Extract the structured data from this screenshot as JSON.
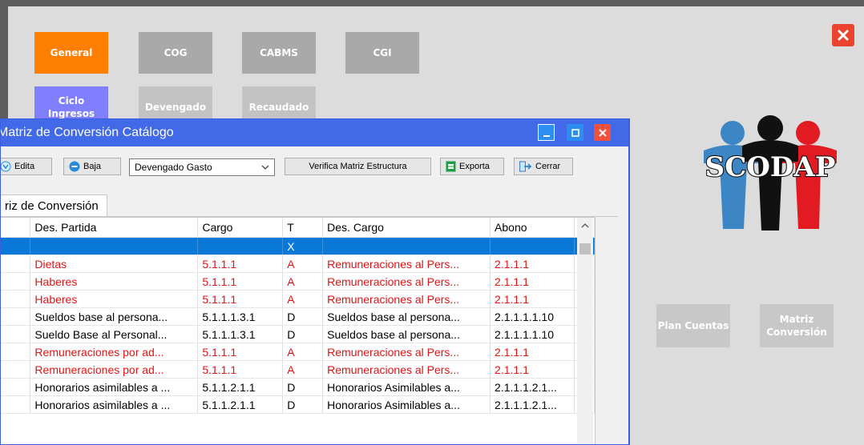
{
  "menu_tiles": [
    {
      "label": "General",
      "color": "#ff7f00"
    },
    {
      "label": "COG",
      "color": "#a9a9a9"
    },
    {
      "label": "CABMS",
      "color": "#a9a9a9"
    },
    {
      "label": "CGI",
      "color": "#a9a9a9"
    },
    {
      "label": "Ciclo Ingresos",
      "color": "#8080ff"
    },
    {
      "label": "Devengado",
      "color": "#c3c3c3"
    },
    {
      "label": "Recaudado",
      "color": "#c3c3c3"
    }
  ],
  "side_tiles": [
    {
      "label": "Plan Cuentas",
      "color": "#c8c8c8"
    },
    {
      "label": "Matriz Conversión",
      "color": "#c8c8c8"
    }
  ],
  "logo": {
    "text": "SCODAP",
    "colors": [
      "#3d86c6",
      "#111111",
      "#e21b23"
    ]
  },
  "window": {
    "title": "Matriz de Conversión Catálogo",
    "titlebar_color": "#4169e8",
    "toolbar": {
      "edit_label": "Edita",
      "delete_label": "Baja",
      "combo_value": "Devengado Gasto",
      "verify_label": "Verifica Matriz Estructura",
      "export_label": "Exporta",
      "close_label": "Cerrar"
    },
    "tab_label": "riz de Conversión",
    "grid": {
      "columns": [
        "Des. Partida",
        "Cargo",
        "T",
        "Des. Cargo",
        "Abono"
      ],
      "rows": [
        {
          "partida": "",
          "cargo": "",
          "t": "X",
          "des_cargo": "",
          "abono": "",
          "style": "sel"
        },
        {
          "partida": "Dietas",
          "cargo": "5.1.1.1",
          "t": "A",
          "des_cargo": "Remuneraciones al Pers...",
          "abono": "2.1.1.1",
          "style": "red"
        },
        {
          "partida": "Haberes",
          "cargo": "5.1.1.1",
          "t": "A",
          "des_cargo": "Remuneraciones al Pers...",
          "abono": "2.1.1.1",
          "style": "red"
        },
        {
          "partida": "Haberes",
          "cargo": "5.1.1.1",
          "t": "A",
          "des_cargo": "Remuneraciones al Pers...",
          "abono": "2.1.1.1",
          "style": "red"
        },
        {
          "partida": "Sueldos base al persona...",
          "cargo": "5.1.1.1.3.1",
          "t": "D",
          "des_cargo": "Sueldos base al persona...",
          "abono": "2.1.1.1.1.10",
          "style": ""
        },
        {
          "partida": "Sueldo Base al Personal...",
          "cargo": "5.1.1.1.3.1",
          "t": "D",
          "des_cargo": "Sueldos base al persona...",
          "abono": "2.1.1.1.1.10",
          "style": ""
        },
        {
          "partida": "Remuneraciones por ad...",
          "cargo": "5.1.1.1",
          "t": "A",
          "des_cargo": "Remuneraciones al Pers...",
          "abono": "2.1.1.1",
          "style": "red"
        },
        {
          "partida": "Remuneraciones por ad...",
          "cargo": "5.1.1.1",
          "t": "A",
          "des_cargo": "Remuneraciones al Pers...",
          "abono": "2.1.1.1",
          "style": "red"
        },
        {
          "partida": "Honorarios asimilables a ...",
          "cargo": "5.1.1.2.1.1",
          "t": "D",
          "des_cargo": "Honorarios Asimilables a...",
          "abono": "2.1.1.1.2.1...",
          "style": ""
        },
        {
          "partida": "Honorarios asimilables a ...",
          "cargo": "5.1.1.2.1.1",
          "t": "D",
          "des_cargo": "Honorarios Asimilables a...",
          "abono": "2.1.1.1.2.1...",
          "style": ""
        }
      ]
    }
  }
}
